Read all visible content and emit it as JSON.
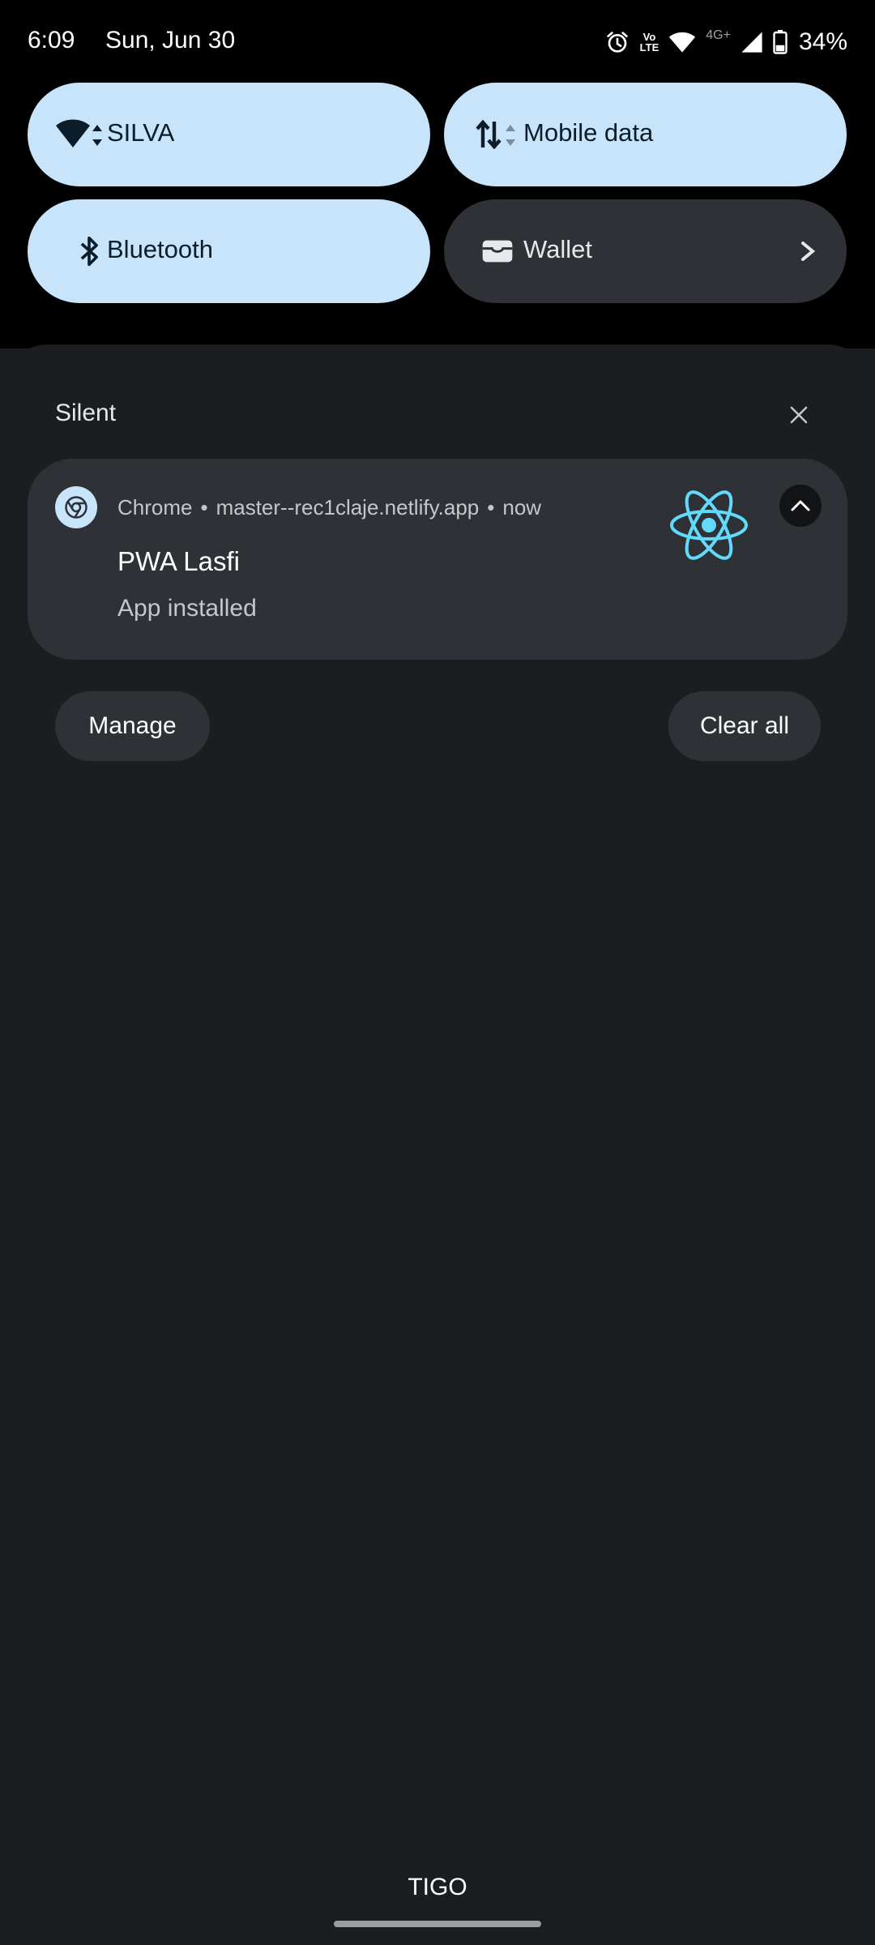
{
  "status_bar": {
    "time": "6:09",
    "date": "Sun, Jun 30",
    "network_type": "4G+",
    "volte_label_top": "Vo",
    "volte_label_bottom": "LTE",
    "battery": "34%",
    "icons": [
      "alarm-icon",
      "volte-icon",
      "wifi-icon",
      "4g-plus-icon",
      "cellular-signal-icon",
      "battery-icon"
    ]
  },
  "quick_settings": {
    "tiles": [
      {
        "label": "SILVA",
        "icon": "wifi-icon",
        "state": "on"
      },
      {
        "label": "Mobile data",
        "icon": "mobile-data-icon",
        "state": "on"
      },
      {
        "label": "Bluetooth",
        "icon": "bluetooth-icon",
        "state": "on"
      },
      {
        "label": "Wallet",
        "icon": "wallet-icon",
        "state": "off"
      }
    ]
  },
  "notifications": {
    "section_label": "Silent",
    "card": {
      "app_name": "Chrome",
      "origin": "master--rec1claje.netlify.app",
      "time": "now",
      "title": "PWA Lasfi",
      "text": "App installed",
      "large_icon": "react-logo-icon"
    },
    "manage_label": "Manage",
    "clear_all_label": "Clear all"
  },
  "carrier": "TIGO",
  "colors": {
    "tile_active": "#c7e4fb",
    "tile_inactive": "#2e3135",
    "shade_bg": "#1b1e21",
    "react_blue": "#61dafb"
  }
}
